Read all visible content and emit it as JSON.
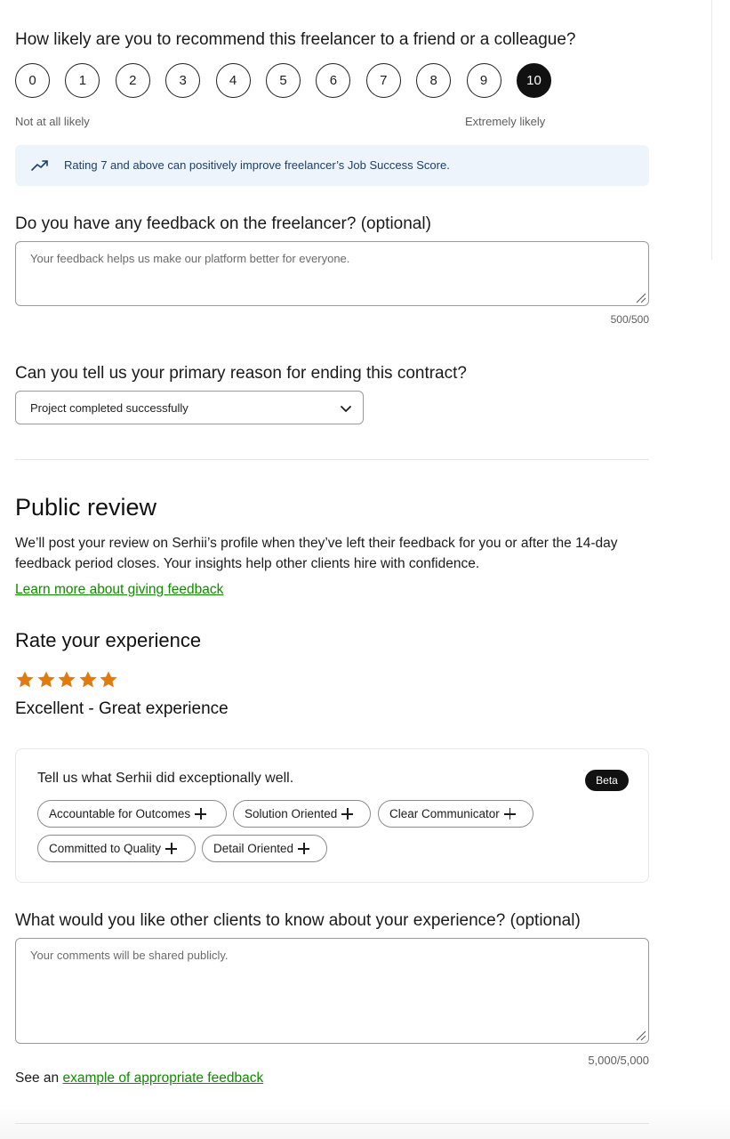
{
  "nps": {
    "question": "How likely are you to recommend this freelancer to a friend or a colleague?",
    "options": [
      "0",
      "1",
      "2",
      "3",
      "4",
      "5",
      "6",
      "7",
      "8",
      "9",
      "10"
    ],
    "selected": "10",
    "low_label": "Not at all likely",
    "high_label": "Extremely likely",
    "info": "Rating 7 and above can positively improve freelancer’s Job Success Score.",
    "info_icon": "trending-up-icon"
  },
  "private_feedback": {
    "question": "Do you have any feedback on the freelancer? (optional)",
    "placeholder": "Your feedback helps us make our platform better for everyone.",
    "counter": "500/500"
  },
  "ending_reason": {
    "question": "Can you tell us your primary reason for ending this contract?",
    "selected": "Project completed successfully"
  },
  "public_review": {
    "title": "Public review",
    "description": "We’ll post your review on Serhii’s profile when they’ve left their feedback for you or after the 14-day feedback period closes. Your insights help other clients hire with confidence.",
    "learn_more": "Learn more about giving feedback"
  },
  "rating": {
    "title": "Rate your experience",
    "stars": 5,
    "star_color": "#e07b12",
    "label": "Excellent - Great experience"
  },
  "strengths": {
    "prompt": "Tell us what Serhii did exceptionally well.",
    "badge": "Beta",
    "chips": [
      "Accountable for Outcomes",
      "Solution Oriented",
      "Clear Communicator",
      "Committed to Quality",
      "Detail Oriented"
    ]
  },
  "public_comment": {
    "question": "What would you like other clients to know about your experience? (optional)",
    "placeholder": "Your comments will be shared publicly.",
    "counter": "5,000/5,000",
    "see_prefix": "See an",
    "see_link": "example of appropriate feedback"
  },
  "colors": {
    "accent_link": "#108a00",
    "info_bg": "#eef4fb",
    "selected_bg": "#111111"
  }
}
